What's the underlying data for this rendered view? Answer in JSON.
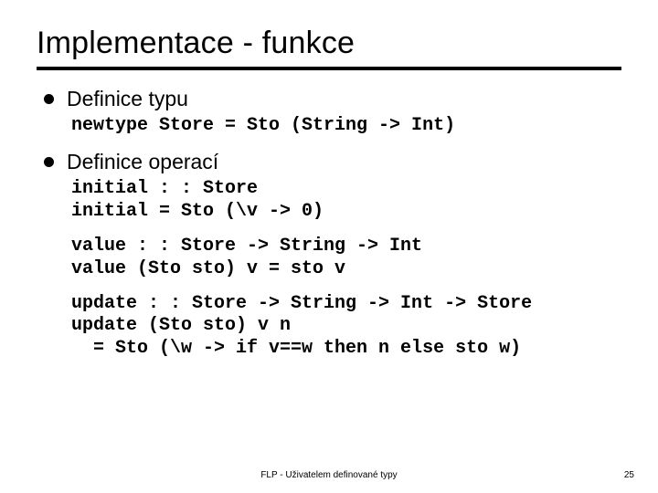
{
  "title": "Implementace - funkce",
  "sections": [
    {
      "heading": "Definice typu",
      "code_blocks": [
        "newtype Store = Sto (String -> Int)"
      ]
    },
    {
      "heading": "Definice operací",
      "code_blocks": [
        "initial : : Store\ninitial = Sto (\\v -> 0)",
        "value : : Store -> String -> Int\nvalue (Sto sto) v = sto v",
        "update : : Store -> String -> Int -> Store\nupdate (Sto sto) v n\n  = Sto (\\w -> if v==w then n else sto w)"
      ]
    }
  ],
  "footer_center": "FLP - Uživatelem definované typy",
  "footer_right": "25"
}
